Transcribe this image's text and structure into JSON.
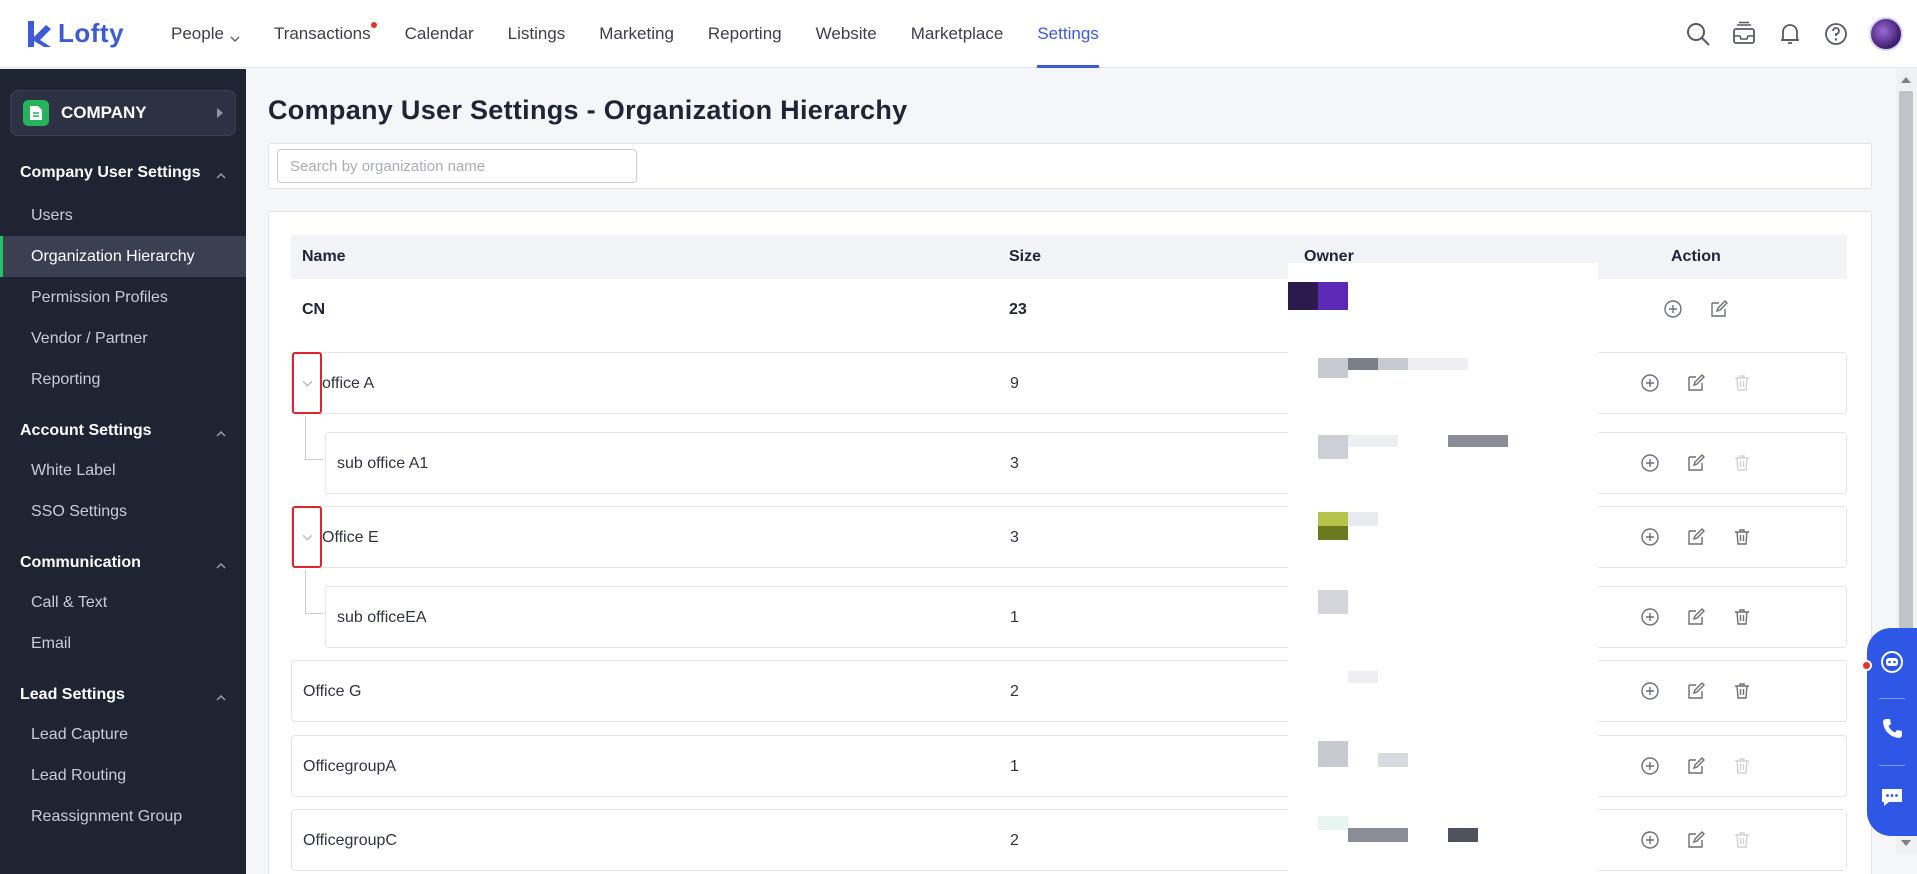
{
  "app": {
    "logo_text": "Lofty"
  },
  "nav": {
    "items": [
      {
        "label": "People",
        "has_chevron": true
      },
      {
        "label": "Transactions",
        "has_dot": true
      },
      {
        "label": "Calendar"
      },
      {
        "label": "Listings"
      },
      {
        "label": "Marketing"
      },
      {
        "label": "Reporting"
      },
      {
        "label": "Website"
      },
      {
        "label": "Marketplace"
      },
      {
        "label": "Settings",
        "active": true
      }
    ],
    "icons": [
      "search-icon",
      "inbox-icon",
      "bell-icon",
      "help-icon",
      "avatar"
    ]
  },
  "sidebar": {
    "company_label": "COMPANY",
    "sections": [
      {
        "title": "Company User Settings",
        "items": [
          "Users",
          "Organization Hierarchy",
          "Permission Profiles",
          "Vendor / Partner",
          "Reporting"
        ]
      },
      {
        "title": "Account Settings",
        "items": [
          "White Label",
          "SSO Settings"
        ]
      },
      {
        "title": "Communication",
        "items": [
          "Call & Text",
          "Email"
        ]
      },
      {
        "title": "Lead Settings",
        "items": [
          "Lead Capture",
          "Lead Routing",
          "Reassignment Group"
        ]
      }
    ],
    "active_item": "Organization Hierarchy"
  },
  "main": {
    "title": "Company User Settings - Organization Hierarchy",
    "search_placeholder": "Search by organization name",
    "table": {
      "columns": {
        "name": "Name",
        "size": "Size",
        "owner": "Owner",
        "action": "Action"
      },
      "rows": [
        {
          "name": "CN",
          "size": "23"
        },
        {
          "name": "office A",
          "size": "9"
        },
        {
          "name": "sub office A1",
          "size": "3"
        },
        {
          "name": "Office E",
          "size": "3"
        },
        {
          "name": "sub officeEA",
          "size": "1"
        },
        {
          "name": "Office G",
          "size": "2"
        },
        {
          "name": "OfficegroupA",
          "size": "1"
        },
        {
          "name": "OfficegroupC",
          "size": "2"
        }
      ]
    }
  },
  "colors": {
    "accent": "#3f5ad6",
    "sidebar_bg": "#1f2433",
    "active_marker": "#23c16b",
    "highlight_border": "#e0232c",
    "float_bar": "#2f57e6"
  }
}
